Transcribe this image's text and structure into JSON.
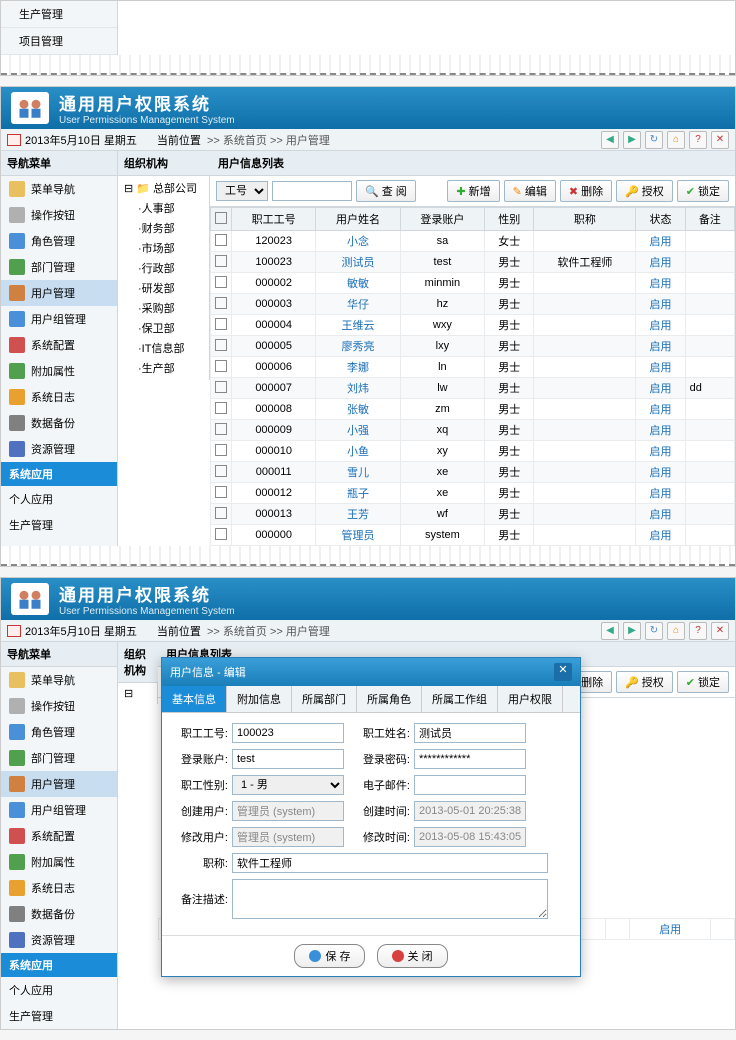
{
  "system": {
    "title": "通用用户权限系统",
    "subtitle": "User Permissions Management System"
  },
  "date": "2013年5月10日 星期五",
  "breadcrumb": {
    "loc_label": "当前位置",
    "sep": ">>",
    "home": "系统首页",
    "page": "用户管理"
  },
  "sidebar_title": "导航菜单",
  "menu": [
    {
      "label": "菜单导航",
      "icon": "#e8c060"
    },
    {
      "label": "操作按钮",
      "icon": "#b0b0b0"
    },
    {
      "label": "角色管理",
      "icon": "#4a90d8"
    },
    {
      "label": "部门管理",
      "icon": "#50a050"
    },
    {
      "label": "用户管理",
      "icon": "#d08040",
      "active": true
    },
    {
      "label": "用户组管理",
      "icon": "#4a90d8"
    },
    {
      "label": "系统配置",
      "icon": "#d05050"
    },
    {
      "label": "附加属性",
      "icon": "#50a050"
    },
    {
      "label": "系统日志",
      "icon": "#e8a030"
    },
    {
      "label": "数据备份",
      "icon": "#808080"
    },
    {
      "label": "资源管理",
      "icon": "#5070c0"
    }
  ],
  "menu_group": "系统应用",
  "extra_menu": [
    "个人应用",
    "生产管理",
    "项目管理"
  ],
  "top_stub_menu": [
    "生产管理",
    "项目管理"
  ],
  "tree_title": "组织机构",
  "tree_root": "总部公司",
  "tree": [
    "人事部",
    "财务部",
    "市场部",
    "行政部",
    "研发部",
    "采购部",
    "保卫部",
    "IT信息部",
    "生产部"
  ],
  "content_title": "用户信息列表",
  "search": {
    "field_label": "工号",
    "placeholder": "",
    "btn": "查 阅"
  },
  "toolbar_btns": {
    "add": "新增",
    "edit": "编辑",
    "delete": "删除",
    "auth": "授权",
    "lock": "锁定"
  },
  "columns": [
    "",
    "职工工号",
    "用户姓名",
    "登录账户",
    "性别",
    "职称",
    "状态",
    "备注"
  ],
  "rows": [
    {
      "id": "120023",
      "name": "小念",
      "account": "sa",
      "gender": "女士",
      "title": "",
      "status": "启用",
      "remark": ""
    },
    {
      "id": "100023",
      "name": "测试员",
      "account": "test",
      "gender": "男士",
      "title": "软件工程师",
      "status": "启用",
      "remark": ""
    },
    {
      "id": "000002",
      "name": "敏敏",
      "account": "minmin",
      "gender": "男士",
      "title": "",
      "status": "启用",
      "remark": ""
    },
    {
      "id": "000003",
      "name": "华仔",
      "account": "hz",
      "gender": "男士",
      "title": "",
      "status": "启用",
      "remark": ""
    },
    {
      "id": "000004",
      "name": "王维云",
      "account": "wxy",
      "gender": "男士",
      "title": "",
      "status": "启用",
      "remark": ""
    },
    {
      "id": "000005",
      "name": "廖秀亮",
      "account": "lxy",
      "gender": "男士",
      "title": "",
      "status": "启用",
      "remark": ""
    },
    {
      "id": "000006",
      "name": "李娜",
      "account": "ln",
      "gender": "男士",
      "title": "",
      "status": "启用",
      "remark": ""
    },
    {
      "id": "000007",
      "name": "刘炜",
      "account": "lw",
      "gender": "男士",
      "title": "",
      "status": "启用",
      "remark": "dd"
    },
    {
      "id": "000008",
      "name": "张敏",
      "account": "zm",
      "gender": "男士",
      "title": "",
      "status": "启用",
      "remark": ""
    },
    {
      "id": "000009",
      "name": "小强",
      "account": "xq",
      "gender": "男士",
      "title": "",
      "status": "启用",
      "remark": ""
    },
    {
      "id": "000010",
      "name": "小鱼",
      "account": "xy",
      "gender": "男士",
      "title": "",
      "status": "启用",
      "remark": ""
    },
    {
      "id": "000011",
      "name": "雪儿",
      "account": "xe",
      "gender": "男士",
      "title": "",
      "status": "启用",
      "remark": ""
    },
    {
      "id": "000012",
      "name": "瓶子",
      "account": "xe",
      "gender": "男士",
      "title": "",
      "status": "启用",
      "remark": ""
    },
    {
      "id": "000013",
      "name": "王芳",
      "account": "wf",
      "gender": "男士",
      "title": "",
      "status": "启用",
      "remark": ""
    },
    {
      "id": "000000",
      "name": "管理员",
      "account": "system",
      "gender": "男士",
      "title": "",
      "status": "启用",
      "remark": ""
    }
  ],
  "modal": {
    "title": "用户信息 - 编辑",
    "tabs": [
      "基本信息",
      "附加信息",
      "所属部门",
      "所属角色",
      "所属工作组",
      "用户权限"
    ],
    "fields": {
      "emp_id_l": "职工工号:",
      "emp_id_v": "100023",
      "emp_name_l": "职工姓名:",
      "emp_name_v": "测试员",
      "account_l": "登录账户:",
      "account_v": "test",
      "password_l": "登录密码:",
      "password_v": "************",
      "gender_l": "职工性别:",
      "gender_v": "1 - 男",
      "email_l": "电子邮件:",
      "email_v": "",
      "create_user_l": "创建用户:",
      "create_user_v": "管理员 (system)",
      "create_time_l": "创建时间:",
      "create_time_v": "2013-05-01 20:25:38",
      "modify_user_l": "修改用户:",
      "modify_user_v": "管理员 (system)",
      "modify_time_l": "修改时间:",
      "modify_time_v": "2013-05-08 15:43:05",
      "title_l": "职称:",
      "title_v": "软件工程师",
      "remark_l": "备注描述:"
    },
    "footer": {
      "save": "保 存",
      "close": "关 闭"
    }
  },
  "bottom_row": {
    "id": "000000",
    "name": "管理员",
    "account": "system",
    "gender": "男士",
    "status": "启用"
  }
}
